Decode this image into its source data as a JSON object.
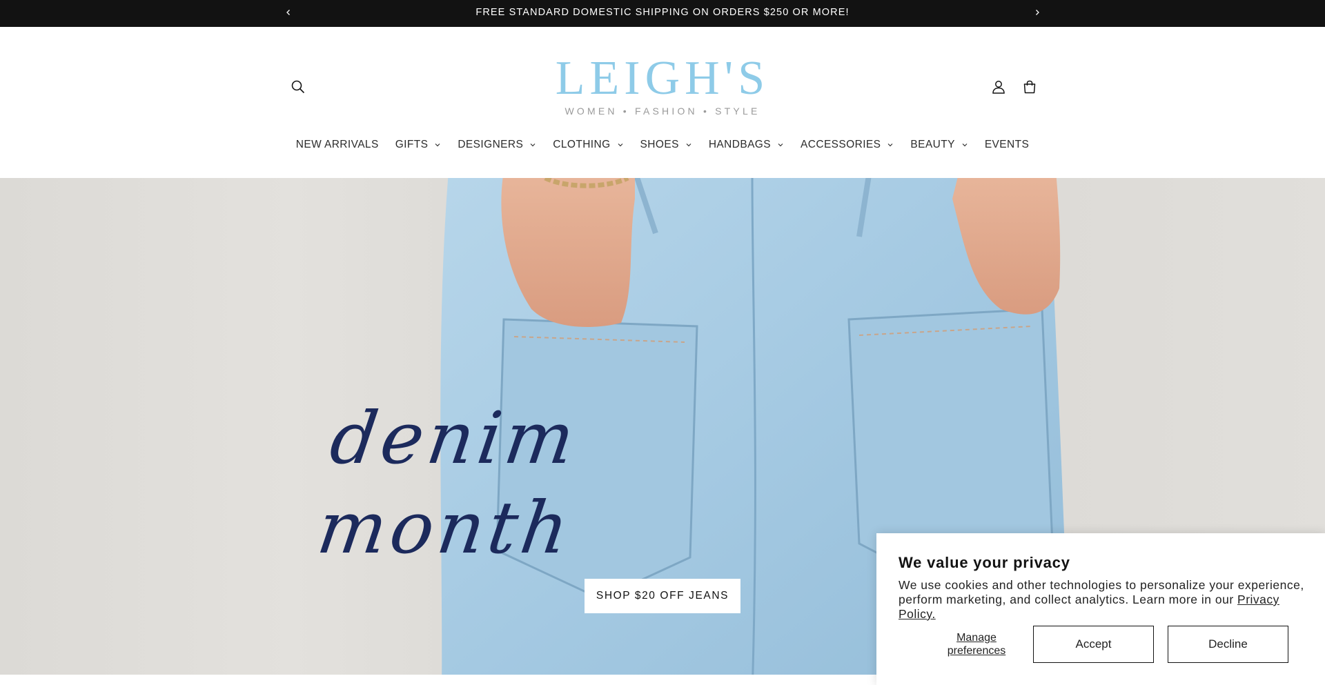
{
  "announcement": {
    "text": "FREE STANDARD DOMESTIC SHIPPING ON ORDERS $250 OR MORE!",
    "prev_icon": "chevron-left-icon",
    "next_icon": "chevron-right-icon"
  },
  "header": {
    "logo": {
      "brand": "LEIGH'S",
      "tagline": "WOMEN • FASHION • STYLE",
      "color": "#8ecbe8"
    },
    "icons": {
      "search": "search-icon",
      "account": "user-icon",
      "cart": "cart-icon"
    }
  },
  "nav": {
    "items": [
      {
        "label": "NEW ARRIVALS",
        "has_dropdown": false
      },
      {
        "label": "GIFTS",
        "has_dropdown": true
      },
      {
        "label": "DESIGNERS",
        "has_dropdown": true
      },
      {
        "label": "CLOTHING",
        "has_dropdown": true
      },
      {
        "label": "SHOES",
        "has_dropdown": true
      },
      {
        "label": "HANDBAGS",
        "has_dropdown": true
      },
      {
        "label": "ACCESSORIES",
        "has_dropdown": true
      },
      {
        "label": "BEAUTY",
        "has_dropdown": true
      },
      {
        "label": "EVENTS",
        "has_dropdown": false
      }
    ]
  },
  "hero": {
    "title": "denim month",
    "cta_label": "SHOP $20 OFF JEANS",
    "title_color": "#1c2a5c",
    "denim_color": "#a9cde4"
  },
  "cookie": {
    "title": "We value your privacy",
    "body": "We use cookies and other technologies to personalize your experience, perform marketing, and collect analytics. Learn more in our ",
    "link": "Privacy Policy.",
    "manage": "Manage preferences",
    "accept": "Accept",
    "decline": "Decline"
  }
}
